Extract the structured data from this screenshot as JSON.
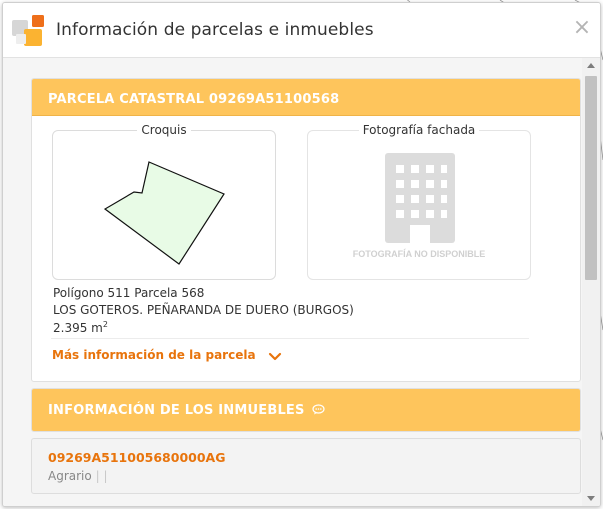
{
  "dialog": {
    "title": "Información de parcelas e inmuebles",
    "close_glyph": "×",
    "logo_icon": "catastro-logo-icon"
  },
  "parcel": {
    "header": "PARCELA CATASTRAL 09269A51100568",
    "sketch_label": "Croquis",
    "photo_label": "Fotografía fachada",
    "photo_unavailable": "FOTOGRAFÍA NO DISPONIBLE",
    "polygon_line": "Polígono 511 Parcela 568",
    "location": "LOS GOTEROS. PEÑARANDA DE DUERO (BURGOS)",
    "area_value": "2.395 m",
    "area_unit_sup": "2",
    "more_info_link": "Más información de la parcela"
  },
  "buildings": {
    "header": "INFORMACIÓN DE LOS INMUEBLES",
    "items": [
      {
        "ref": "09269A511005680000AG",
        "use": "Agrario",
        "extra1": "|",
        "extra2": "|"
      }
    ]
  },
  "colors": {
    "panel_header": "#fec55c",
    "link_orange": "#e8740c",
    "sketch_fill": "#e8fbe6"
  }
}
